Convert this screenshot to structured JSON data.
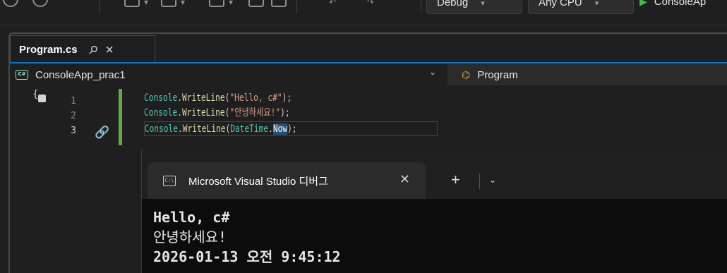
{
  "toolbar": {
    "config_combo": "Debug",
    "platform_combo": "Any CPU",
    "run_target": "ConsoleAp"
  },
  "document_tab": {
    "label": "Program.cs"
  },
  "navigation": {
    "project": "ConsoleApp_prac1",
    "project_icon_text": "C#",
    "class": "Program"
  },
  "code": {
    "line_numbers": [
      "1",
      "2",
      "3"
    ],
    "lines": [
      {
        "class": "Console",
        "dot": ".",
        "method": "WriteLine",
        "open": "(",
        "arg": "\"Hello, c#\"",
        "close": ");"
      },
      {
        "class": "Console",
        "dot": ".",
        "method": "WriteLine",
        "open": "(",
        "arg": "\"안녕하세요!\"",
        "close": ");"
      },
      {
        "class": "Console",
        "dot": ".",
        "method": "WriteLine",
        "open": "(",
        "arg_class": "DateTime",
        "arg_dot": ".",
        "arg_prop": "Now",
        "close": ");"
      }
    ]
  },
  "console": {
    "tab_title": "Microsoft Visual Studio 디버그",
    "cmd_icon_text": "C:\\",
    "add_label": "+",
    "output": [
      "Hello, c#",
      "안녕하세요!",
      "2026-01-13 오전 9:45:12"
    ]
  }
}
